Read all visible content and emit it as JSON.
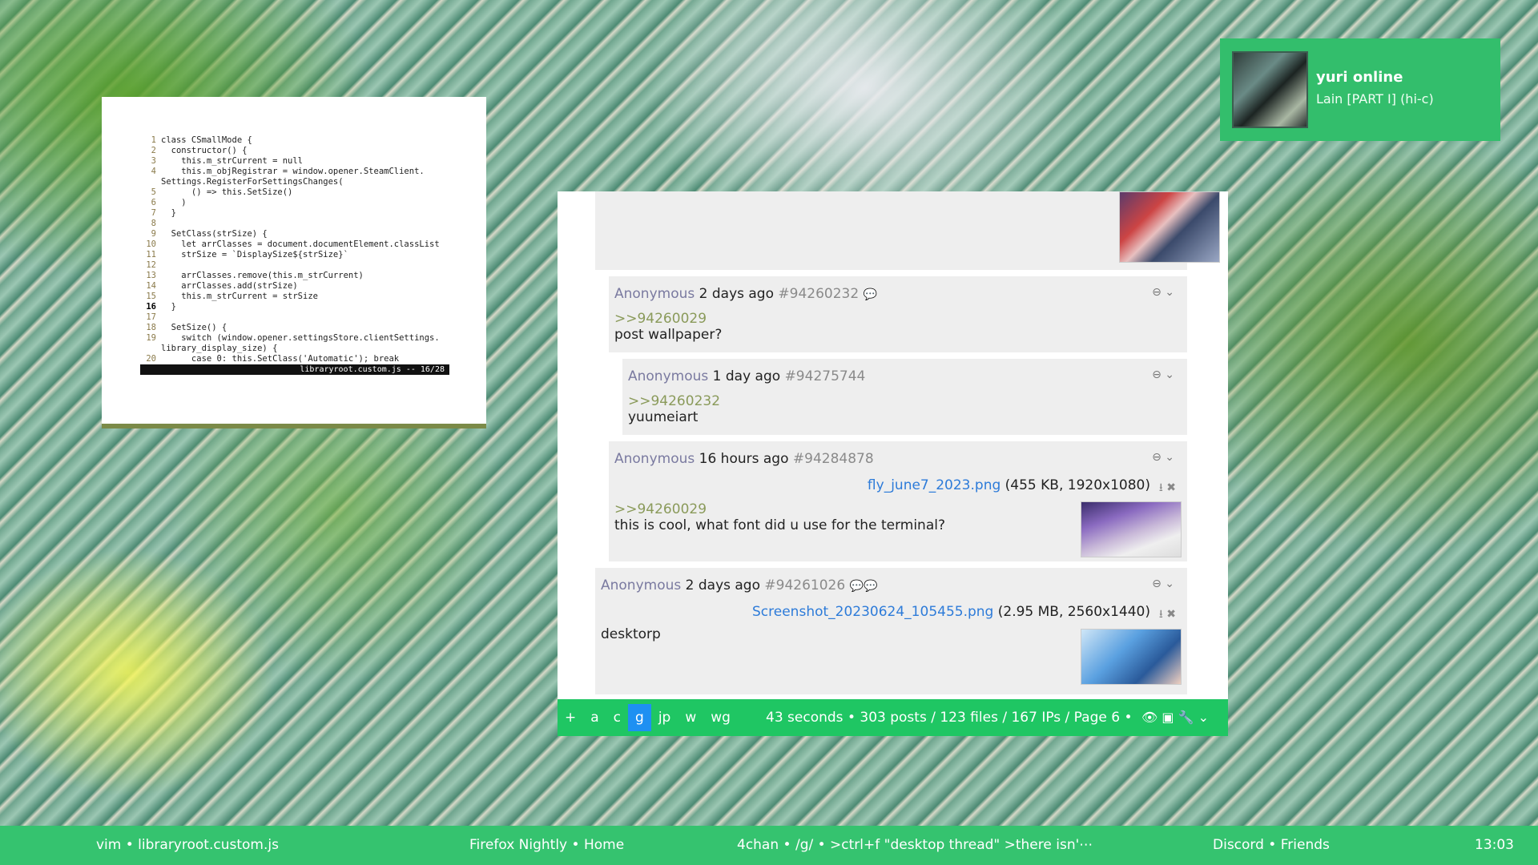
{
  "vim": {
    "lines": [
      {
        "n": "1",
        "t": "class CSmallMode {"
      },
      {
        "n": "2",
        "t": "  constructor() {"
      },
      {
        "n": "3",
        "t": "    this.m_strCurrent = null"
      },
      {
        "n": "4",
        "t": "    this.m_objRegistrar = window.opener.SteamClient."
      },
      {
        "n": "",
        "t": "Settings.RegisterForSettingsChanges("
      },
      {
        "n": "5",
        "t": "      () => this.SetSize()"
      },
      {
        "n": "6",
        "t": "    )"
      },
      {
        "n": "7",
        "t": "  }"
      },
      {
        "n": "8",
        "t": ""
      },
      {
        "n": "9",
        "t": "  SetClass(strSize) {"
      },
      {
        "n": "10",
        "t": "    let arrClasses = document.documentElement.classList"
      },
      {
        "n": "11",
        "t": "    strSize = `DisplaySize${strSize}`"
      },
      {
        "n": "12",
        "t": ""
      },
      {
        "n": "13",
        "t": "    arrClasses.remove(this.m_strCurrent)"
      },
      {
        "n": "14",
        "t": "    arrClasses.add(strSize)"
      },
      {
        "n": "15",
        "t": "    this.m_strCurrent = strSize"
      },
      {
        "n": "16",
        "t": "  }"
      },
      {
        "n": "17",
        "t": ""
      },
      {
        "n": "18",
        "t": "  SetSize() {"
      },
      {
        "n": "19",
        "t": "    switch (window.opener.settingsStore.clientSettings."
      },
      {
        "n": "",
        "t": "library_display_size) {"
      },
      {
        "n": "20",
        "t": "      case 0: this.SetClass('Automatic'); break"
      }
    ],
    "status": "libraryroot.custom.js -- 16/28"
  },
  "notification": {
    "title": "yuri online",
    "subtitle": "Lain [PART I] (hi-c)"
  },
  "posts": [
    {
      "name": "Anonymous",
      "time": "2 days ago",
      "id": "#94260232",
      "quote": ">>94260029",
      "body": "post wallpaper?"
    },
    {
      "name": "Anonymous",
      "time": "1 day ago",
      "id": "#94275744",
      "quote": ">>94260232",
      "body": "yuumeiart"
    },
    {
      "name": "Anonymous",
      "time": "16 hours ago",
      "id": "#94284878",
      "file_name": "fly_june7_2023.png",
      "file_meta": "(455 KB, 1920x1080)",
      "quote": ">>94260029",
      "body": "this is cool, what font did u use for the terminal?"
    },
    {
      "name": "Anonymous",
      "time": "2 days ago",
      "id": "#94261026",
      "file_name": "Screenshot_20230624_105455.png",
      "file_meta": "(2.95 MB, 2560x1440)",
      "body": "desktorp"
    }
  ],
  "nav": {
    "boards": [
      "+",
      "a",
      "c",
      "g",
      "jp",
      "w",
      "wg"
    ],
    "selected_board": "g",
    "updated": "43 seconds",
    "stats": "303 posts / 123 files / 167 IPs / Page 6",
    "icons": [
      "eye-icon",
      "image-icon",
      "wrench-icon",
      "chevron-down-icon"
    ]
  },
  "taskbar": {
    "item1": "vim • libraryroot.custom.js",
    "item2": "Firefox Nightly • Home",
    "item3": "4chan • /g/ • >ctrl+f \"desktop thread\" >there isn'⋯",
    "item4": "Discord • Friends",
    "clock": "13:03"
  },
  "colors": {
    "taskbar": "#35c36f",
    "navbar": "#1fc663",
    "selected_board": "#1e90f2",
    "link": "#2d7bd9",
    "quote": "#8a9a5a"
  }
}
